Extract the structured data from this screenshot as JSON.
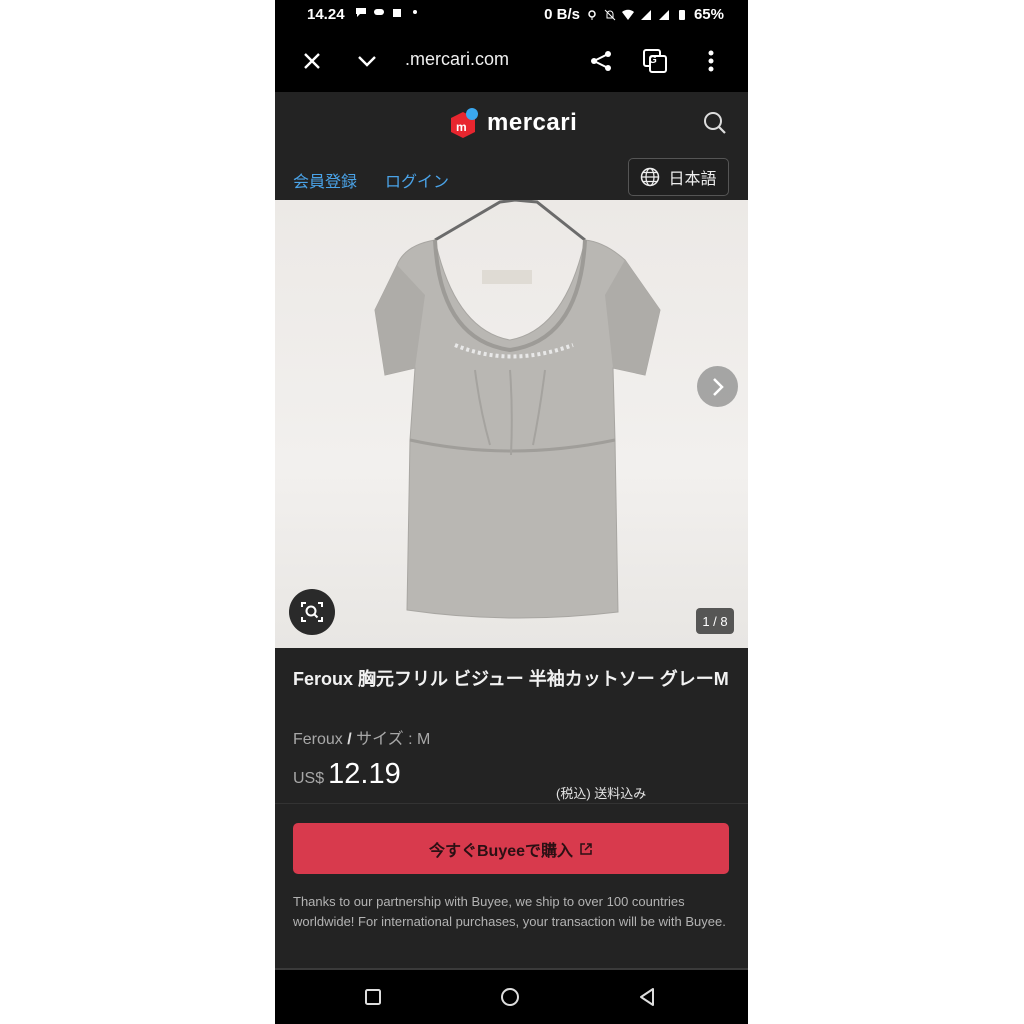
{
  "status_bar": {
    "time": "14.24",
    "network_speed": "0 B/s",
    "battery": "65%"
  },
  "browser": {
    "url": ".mercari.com",
    "icons": [
      "close-icon",
      "chevron-down-icon",
      "share-icon",
      "translate-icon",
      "more-vert-icon"
    ]
  },
  "site": {
    "logo_text": "mercari",
    "logo_badge": "m",
    "nav": {
      "register": "会員登録",
      "login": "ログイン",
      "language": "日本語"
    }
  },
  "gallery": {
    "counter": "1 / 8"
  },
  "product": {
    "brand": "Feroux",
    "title_rest": " 胸元フリル ビジュー 半袖カットソー グレーM",
    "meta_brand": "Feroux",
    "meta_separator": " / ",
    "meta_size": "サイズ : M",
    "currency": "US$",
    "price": "12.19",
    "tax_shipping": "(税込) 送料込み"
  },
  "purchase": {
    "buy_label": "今すぐBuyeeで購入",
    "note": "Thanks to our partnership with Buyee, we ship to over 100 countries worldwide! For international purchases, your transaction will be with Buyee."
  },
  "colors": {
    "accent_link": "#4aa3e8",
    "buy_button": "#d83a4d",
    "logo_red": "#e8262f",
    "logo_blue": "#3aa8f0"
  }
}
